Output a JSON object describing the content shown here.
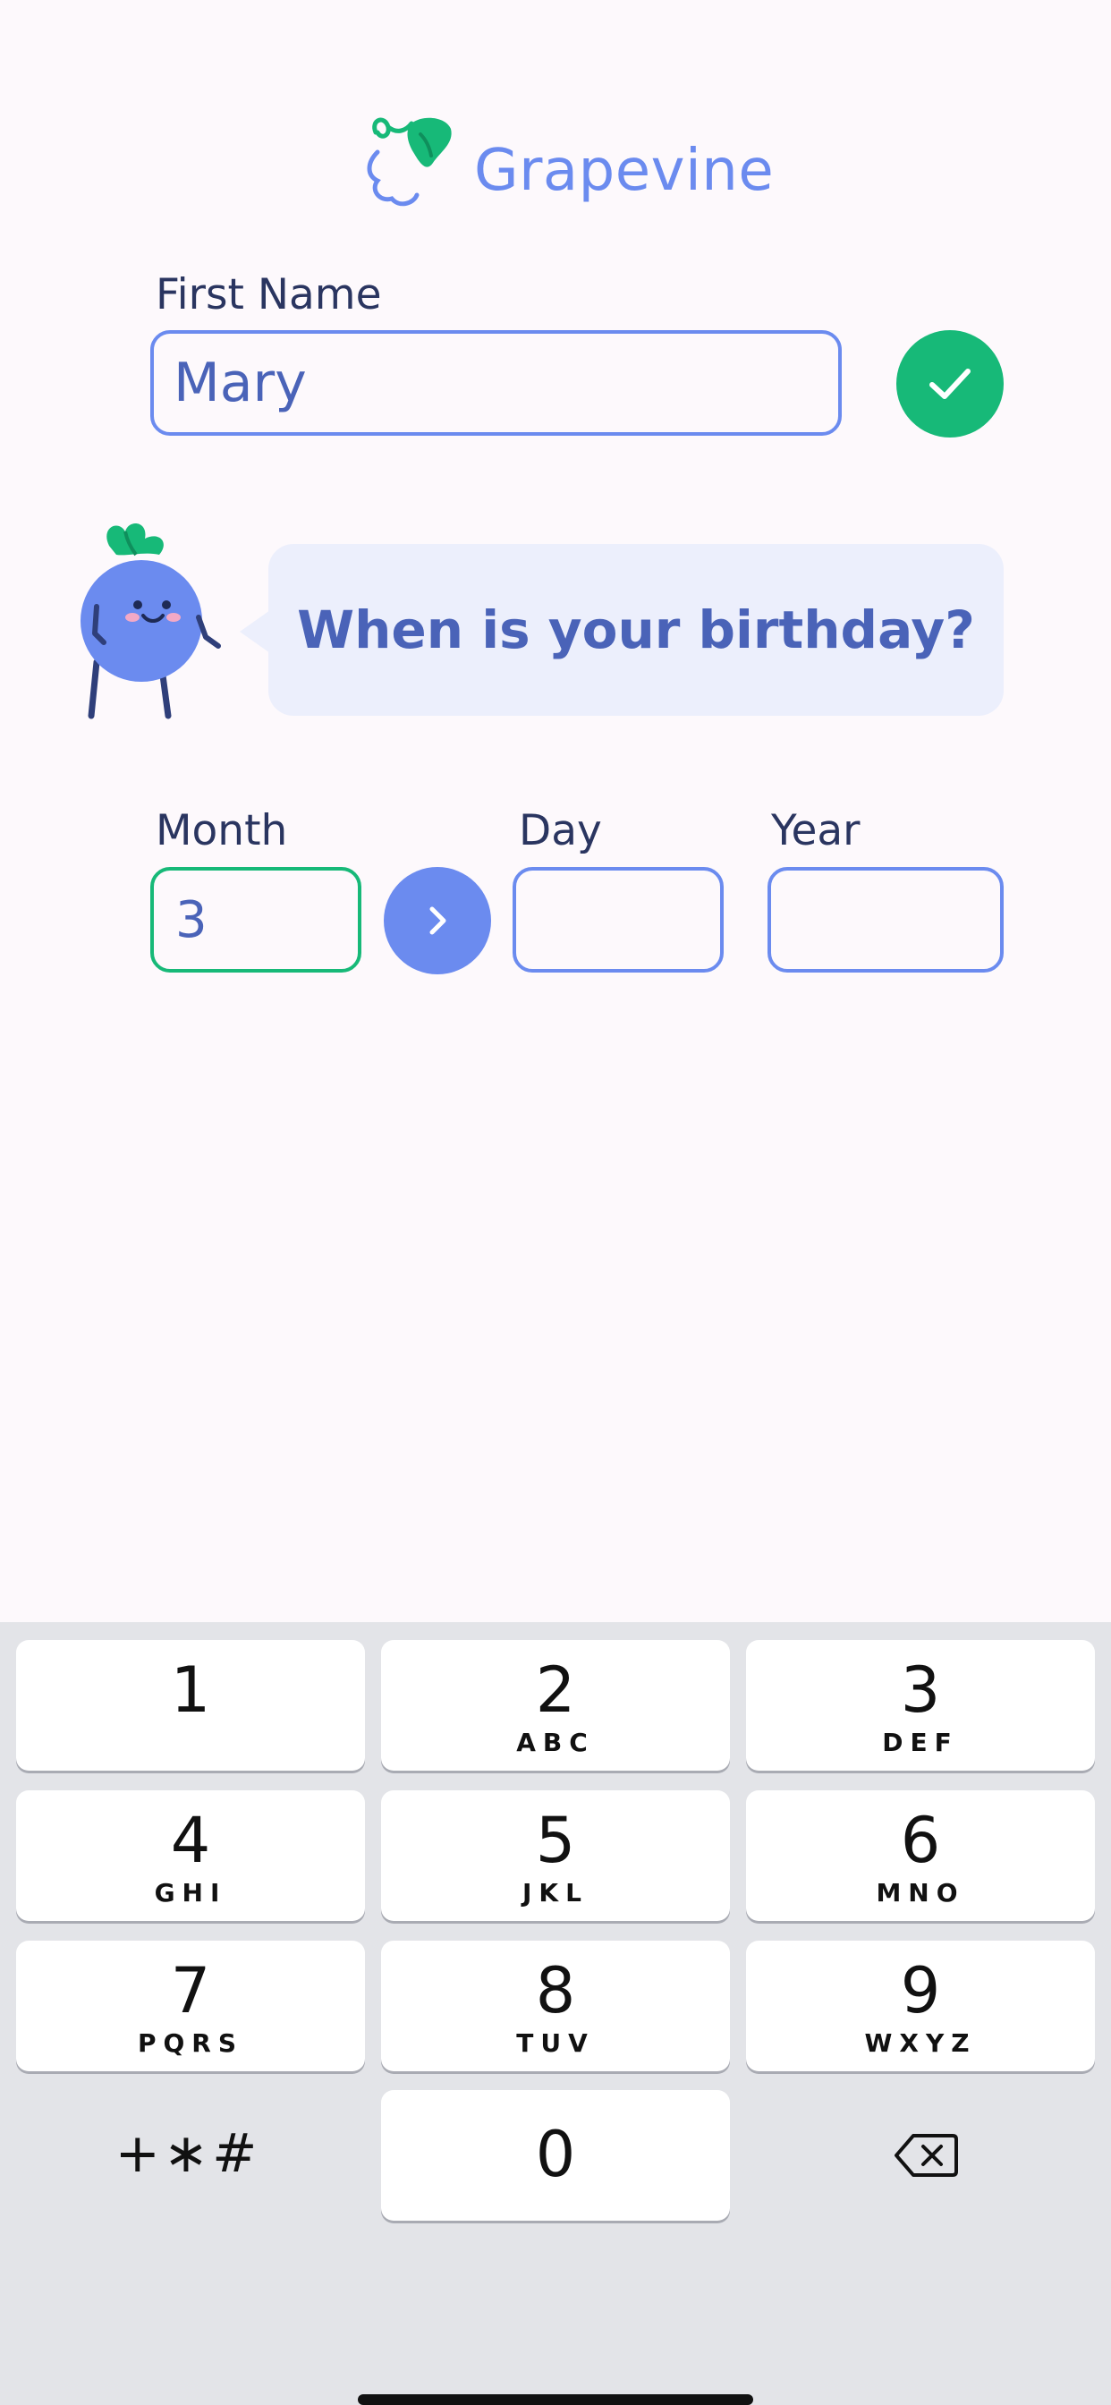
{
  "app": {
    "name": "Grapevine"
  },
  "colors": {
    "accent": "#6b8bef",
    "success": "#17b978",
    "text_dark": "#2a3560",
    "text_blue": "#4a63b8"
  },
  "form": {
    "first_name_label": "First Name",
    "first_name_value": "Mary",
    "question": "When is your birthday?",
    "month_label": "Month",
    "month_value": "3",
    "day_label": "Day",
    "day_value": "",
    "year_label": "Year",
    "year_value": ""
  },
  "icons": {
    "confirm": "check-icon",
    "next": "chevron-right-icon",
    "delete": "backspace-icon"
  },
  "keypad": {
    "keys": [
      {
        "digit": "1",
        "letters": ""
      },
      {
        "digit": "2",
        "letters": "ABC"
      },
      {
        "digit": "3",
        "letters": "DEF"
      },
      {
        "digit": "4",
        "letters": "GHI"
      },
      {
        "digit": "5",
        "letters": "JKL"
      },
      {
        "digit": "6",
        "letters": "MNO"
      },
      {
        "digit": "7",
        "letters": "PQRS"
      },
      {
        "digit": "8",
        "letters": "TUV"
      },
      {
        "digit": "9",
        "letters": "WXYZ"
      },
      {
        "digit": "0",
        "letters": ""
      }
    ],
    "symbols": "+∗#"
  }
}
